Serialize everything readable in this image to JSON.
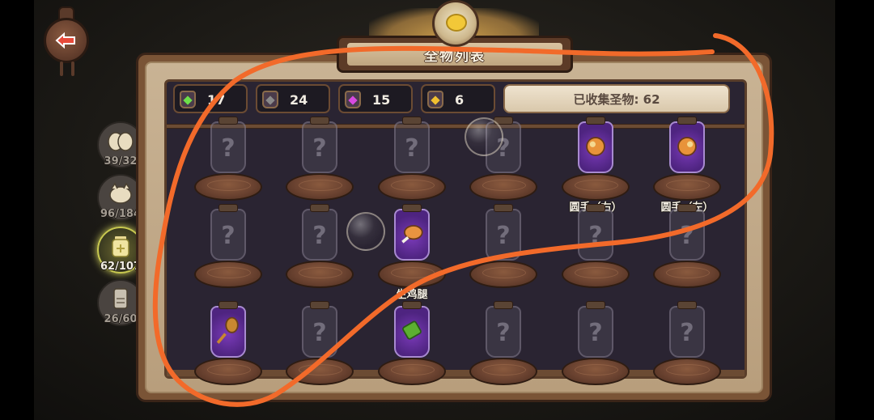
{
  "header": {
    "title": "全物列表"
  },
  "counters": [
    {
      "value": "17",
      "color": "#6de04a",
      "icon": "green-gem-icon"
    },
    {
      "value": "24",
      "color": "#8a8a8a",
      "icon": "gray-gem-icon"
    },
    {
      "value": "15",
      "color": "#d84ae0",
      "icon": "purple-gem-icon"
    },
    {
      "value": "6",
      "color": "#f0c030",
      "icon": "gold-gem-icon"
    }
  ],
  "collected": "已收集圣物: 62",
  "tabs": [
    {
      "count": "39/32",
      "icon": "eggs-icon"
    },
    {
      "count": "96/184",
      "icon": "creature-icon"
    },
    {
      "count": "62/107",
      "icon": "relic-jar-icon",
      "active": true
    },
    {
      "count": "26/60",
      "icon": "locked-tab-icon"
    }
  ],
  "items": [
    {
      "label": "",
      "filled": false
    },
    {
      "label": "",
      "filled": false
    },
    {
      "label": "",
      "filled": false
    },
    {
      "label": "",
      "filled": false
    },
    {
      "label": "圆手（右）",
      "filled": true,
      "icon": "right-glove-icon"
    },
    {
      "label": "圆手（左）",
      "filled": true,
      "icon": "left-glove-icon"
    },
    {
      "label": "",
      "filled": false
    },
    {
      "label": "",
      "filled": false
    },
    {
      "label": "生鸡腿",
      "filled": true,
      "icon": "chicken-leg-icon"
    },
    {
      "label": "",
      "filled": false
    },
    {
      "label": "",
      "filled": false
    },
    {
      "label": "",
      "filled": false
    },
    {
      "label": "",
      "filled": true,
      "icon": "wooden-spoon-icon"
    },
    {
      "label": "",
      "filled": false
    },
    {
      "label": "",
      "filled": true,
      "icon": "green-scroll-icon"
    },
    {
      "label": "",
      "filled": false
    },
    {
      "label": "",
      "filled": false
    },
    {
      "label": "",
      "filled": false
    }
  ],
  "question_mark": "?",
  "colors": {
    "annotation": "#f26a2a",
    "panel": "#7a5436",
    "slot_bg": "#2a2432"
  }
}
